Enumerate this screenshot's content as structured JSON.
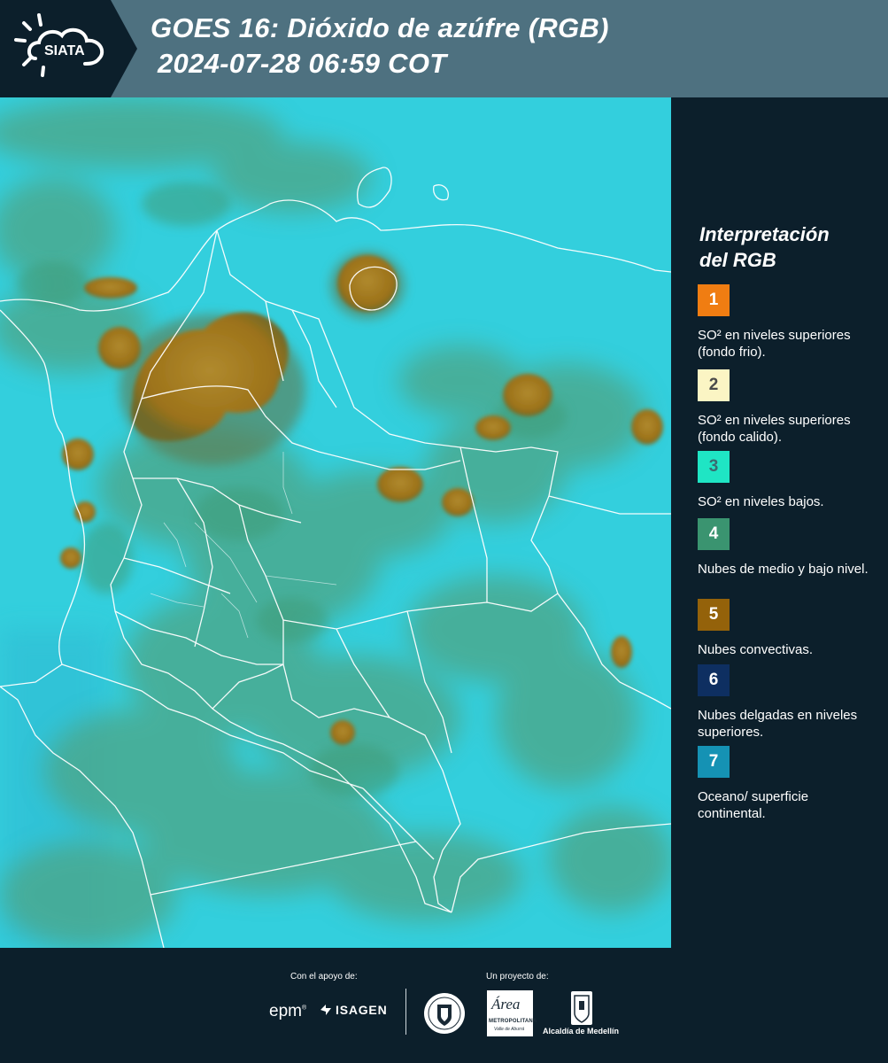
{
  "header": {
    "logo_text": "SIATA",
    "title_line1": "GOES 16: Dióxido de azúfre (RGB)",
    "title_line2": "2024-07-28 06:59 COT"
  },
  "legend": {
    "title_line1": "Interpretación",
    "title_line2": "del RGB",
    "items": [
      {
        "number": "1",
        "color": "#f07d12",
        "label": "SO² en niveles superiores (fondo frio)."
      },
      {
        "number": "2",
        "color": "#fbf5c4",
        "label": "SO² en niveles superiores (fondo calido)."
      },
      {
        "number": "3",
        "color": "#1fe5c4",
        "label": "SO² en niveles bajos."
      },
      {
        "number": "4",
        "color": "#3a9470",
        "label": "Nubes de medio y bajo nivel."
      },
      {
        "number": "5",
        "color": "#94620a",
        "label": "Nubes convectivas."
      },
      {
        "number": "6",
        "color": "#0e2f61",
        "label": "Nubes delgadas en niveles superiores."
      },
      {
        "number": "7",
        "color": "#1592b4",
        "label": "Oceano/ superficie continental."
      }
    ]
  },
  "footer": {
    "support_caption": "Con el apoyo de:",
    "project_caption": "Un proyecto de:",
    "epm": "epm",
    "isagen": "ISAGEN",
    "area_name": "Área",
    "area_sub1": "METROPOLITANA",
    "area_sub2": "Valle de Aburrá",
    "alcaldia": "Alcaldía de Medellín"
  },
  "colors": {
    "header_bg": "#4e7180",
    "panel_bg": "#0c1f2b",
    "ocean_cyan": "#2fc9d9",
    "cloud_green": "#4fa584",
    "convective_brown": "#a27a1c"
  }
}
